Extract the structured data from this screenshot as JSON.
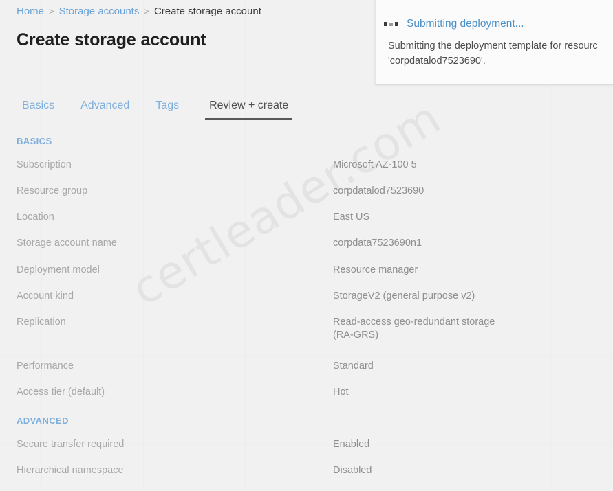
{
  "breadcrumb": {
    "items": [
      {
        "label": "Home",
        "link": true
      },
      {
        "label": "Storage accounts",
        "link": true
      },
      {
        "label": "Create storage account",
        "link": false
      }
    ],
    "separator": ">"
  },
  "page": {
    "title": "Create storage account"
  },
  "tabs": [
    {
      "label": "Basics",
      "active": false
    },
    {
      "label": "Advanced",
      "active": false
    },
    {
      "label": "Tags",
      "active": false
    },
    {
      "label": "Review + create",
      "active": true
    }
  ],
  "sections": [
    {
      "heading": "BASICS",
      "rows": [
        {
          "label": "Subscription",
          "value": "Microsoft AZ-100 5"
        },
        {
          "label": "Resource group",
          "value": "corpdatalod7523690"
        },
        {
          "label": "Location",
          "value": "East US"
        },
        {
          "label": "Storage account name",
          "value": "corpdata7523690n1"
        },
        {
          "label": "Deployment model",
          "value": "Resource manager"
        },
        {
          "label": "Account kind",
          "value": "StorageV2 (general purpose v2)"
        },
        {
          "label": "Replication",
          "value": "Read-access geo-redundant storage\n(RA-GRS)"
        },
        {
          "label": "Performance",
          "value": "Standard",
          "gap_before": true
        },
        {
          "label": "Access tier (default)",
          "value": "Hot"
        }
      ]
    },
    {
      "heading": "ADVANCED",
      "rows": [
        {
          "label": "Secure transfer required",
          "value": "Enabled"
        },
        {
          "label": "Hierarchical namespace",
          "value": "Disabled"
        }
      ]
    }
  ],
  "notification": {
    "icon": "in-progress-icon",
    "title": "Submitting deployment...",
    "body": "Submitting the deployment template for resourc\n'corpdatalod7523690'."
  },
  "watermark": {
    "text": "certleader.com"
  },
  "colors": {
    "link_blue": "#6aa3d8",
    "section_heading_blue": "#7fb0dd",
    "notification_title_blue": "#4a90c8",
    "page_background": "#f1f1f1",
    "label_gray": "#a8a8a8",
    "value_gray": "#8f8f8f",
    "active_tab": "#4e4e4e"
  }
}
